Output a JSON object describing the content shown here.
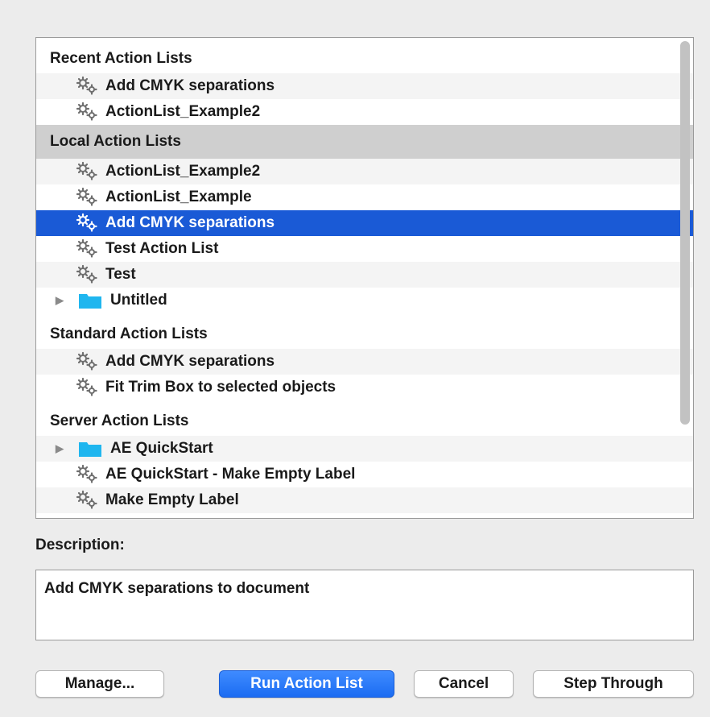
{
  "list": {
    "sections": [
      {
        "title": "Recent Action Lists",
        "items": [
          {
            "label": "Add CMYK separations",
            "icon": "gear-icon"
          },
          {
            "label": "ActionList_Example2",
            "icon": "gear-icon"
          }
        ]
      },
      {
        "title": "Local Action Lists",
        "items": [
          {
            "label": "ActionList_Example2",
            "icon": "gear-icon"
          },
          {
            "label": "ActionList_Example",
            "icon": "gear-icon"
          },
          {
            "label": "Add CMYK separations",
            "icon": "gear-icon",
            "selected": true
          },
          {
            "label": "Test Action List",
            "icon": "gear-icon"
          },
          {
            "label": "Test",
            "icon": "gear-icon"
          },
          {
            "label": "Untitled",
            "icon": "folder-icon"
          }
        ]
      },
      {
        "title": "Standard Action Lists",
        "items": [
          {
            "label": "Add CMYK separations",
            "icon": "gear-icon"
          },
          {
            "label": "Fit Trim Box to selected objects",
            "icon": "gear-icon"
          }
        ]
      },
      {
        "title": "Server Action Lists",
        "items": [
          {
            "label": "AE QuickStart",
            "icon": "folder-icon"
          },
          {
            "label": "AE QuickStart - Make Empty Label",
            "icon": "gear-icon"
          },
          {
            "label": "Make Empty Label",
            "icon": "gear-icon"
          }
        ]
      }
    ]
  },
  "description": {
    "label": "Description:",
    "text": "Add CMYK separations to document"
  },
  "buttons": {
    "manage": "Manage...",
    "run": "Run Action List",
    "cancel": "Cancel",
    "step": "Step Through"
  },
  "colors": {
    "selection": "#1a5ad6",
    "folder": "#1fb6ef",
    "primary_button": "#1b6cf2"
  }
}
